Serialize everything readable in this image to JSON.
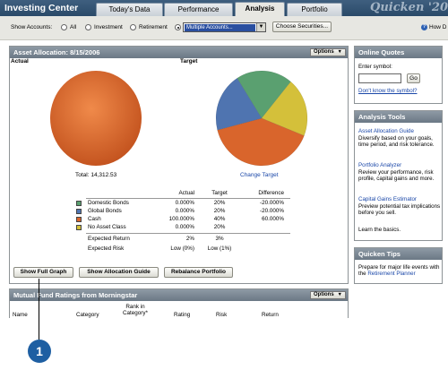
{
  "app": {
    "title": "Investing Center",
    "brand": "Quicken '20"
  },
  "tabs": [
    {
      "label": "Today's Data"
    },
    {
      "label": "Performance"
    },
    {
      "label": "Analysis"
    },
    {
      "label": "Portfolio"
    }
  ],
  "accounts": {
    "label": "Show Accounts:",
    "options": [
      "All",
      "Investment",
      "Retirement"
    ],
    "selected_value": "Multiple Accounts...",
    "choose_button": "Choose Securities...",
    "how_do_i": "How D"
  },
  "allocation": {
    "header": "Asset Allocation:  8/15/2006",
    "options_label": "Options",
    "actual_label": "Actual",
    "target_label": "Target",
    "total": "Total: 14,312.53",
    "change_target": "Change Target",
    "columns": [
      "Actual",
      "Target",
      "Difference"
    ],
    "rows": [
      {
        "name": "Domestic Bonds",
        "actual": "0.000%",
        "target": "20%",
        "diff": "-20.000%",
        "color": "#5aa070"
      },
      {
        "name": "Global Bonds",
        "actual": "0.000%",
        "target": "20%",
        "diff": "-20.000%",
        "color": "#4f74b0"
      },
      {
        "name": "Cash",
        "actual": "100.000%",
        "target": "40%",
        "diff": "60.000%",
        "color": "#d9652c"
      },
      {
        "name": "No Asset Class",
        "actual": "0.000%",
        "target": "20%",
        "diff": "",
        "color": "#d4c03a"
      }
    ],
    "expected_return": {
      "label": "Expected Return",
      "actual": "2%",
      "target": "3%"
    },
    "expected_risk": {
      "label": "Expected Risk",
      "actual": "Low (0%)",
      "target": "Low (1%)"
    },
    "target_pie": [
      {
        "name": "Domestic Bonds",
        "pct": 20,
        "color": "#5aa070"
      },
      {
        "name": "No Asset Class",
        "pct": 20,
        "color": "#d4c03a"
      },
      {
        "name": "Cash",
        "pct": 40,
        "color": "#d9652c"
      },
      {
        "name": "Global Bonds",
        "pct": 20,
        "color": "#4f74b0"
      }
    ],
    "buttons": {
      "show_full_graph": "Show Full Graph",
      "show_allocation_guide": "Show Allocation Guide",
      "rebalance": "Rebalance Portfolio"
    }
  },
  "mutual_fund": {
    "header": "Mutual Fund Ratings from Morningstar",
    "options_label": "Options",
    "columns": [
      "Name",
      "Category",
      "Rank in Category*",
      "Rating",
      "Risk",
      "Return"
    ]
  },
  "sidebar": {
    "online_quotes": {
      "header": "Online Quotes",
      "enter_symbol": "Enter symbol:",
      "go": "Go",
      "dont_know": "Don't know the symbol?"
    },
    "analysis_tools": {
      "header": "Analysis Tools",
      "items": [
        {
          "title": "Asset Allocation Guide",
          "desc": "Diversify based on your goals, time period, and risk tolerance."
        },
        {
          "title": "Portfolio Analyzer",
          "desc": "Review your performance, risk profile, capital gains and more."
        },
        {
          "title": "Capital Gains Estimator",
          "desc": "Preview potential tax implications before you sell."
        }
      ],
      "learn": "Learn the basics."
    },
    "quicken_tips": {
      "header": "Quicken Tips",
      "text": "Prepare for major life events with the",
      "link": "Retirement Planner"
    }
  },
  "callout": {
    "number": "1"
  },
  "colors": {
    "header": "#6b7885",
    "topbar": "#2a4a69",
    "link": "#1a47a8",
    "callout": "#1e5fa2"
  }
}
